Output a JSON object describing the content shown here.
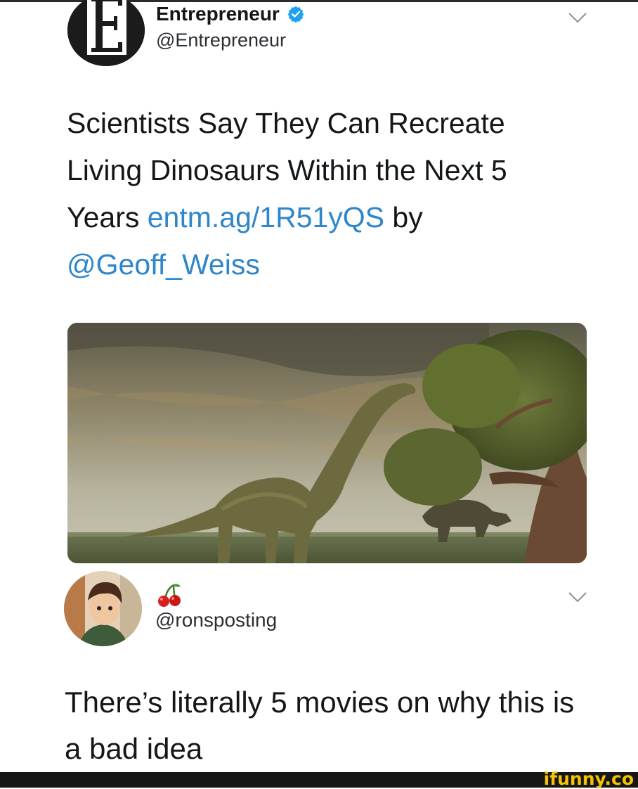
{
  "tweet": {
    "author_name": "Entrepreneur",
    "author_handle": "@Entrepreneur",
    "avatar_letter": "E",
    "text_main": "Scientists Say They Can Recreate Living Dinosaurs Within the Next 5 Years ",
    "link": "entm.ag/1R51yQS",
    "text_by": " by ",
    "mention": "@Geoff_Weiss",
    "verified_color": "#1da1f2",
    "link_color": "#2f86c9"
  },
  "reply": {
    "emoji": "🍒",
    "author_handle": "@ronsposting",
    "text": "There’s literally 5 movies on why this is a bad idea"
  },
  "watermark": {
    "text": "ifunny.co",
    "color": "#f5c400"
  },
  "icons": [
    "verified-badge-icon",
    "chevron-down-icon",
    "cherry-icon"
  ]
}
